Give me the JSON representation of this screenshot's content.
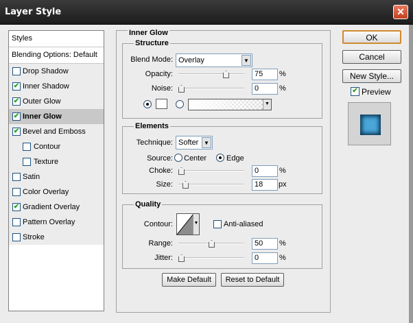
{
  "window": {
    "title": "Layer Style",
    "close_icon": "close-icon"
  },
  "styles_panel": {
    "header": "Styles",
    "blending_options": "Blending Options: Default",
    "items": [
      {
        "label": "Drop Shadow",
        "checked": false,
        "sub": false,
        "selected": false
      },
      {
        "label": "Inner Shadow",
        "checked": true,
        "sub": false,
        "selected": false
      },
      {
        "label": "Outer Glow",
        "checked": true,
        "sub": false,
        "selected": false
      },
      {
        "label": "Inner Glow",
        "checked": true,
        "sub": false,
        "selected": true
      },
      {
        "label": "Bevel and Emboss",
        "checked": true,
        "sub": false,
        "selected": false
      },
      {
        "label": "Contour",
        "checked": false,
        "sub": true,
        "selected": false
      },
      {
        "label": "Texture",
        "checked": false,
        "sub": true,
        "selected": false
      },
      {
        "label": "Satin",
        "checked": false,
        "sub": false,
        "selected": false
      },
      {
        "label": "Color Overlay",
        "checked": false,
        "sub": false,
        "selected": false
      },
      {
        "label": "Gradient Overlay",
        "checked": true,
        "sub": false,
        "selected": false
      },
      {
        "label": "Pattern Overlay",
        "checked": false,
        "sub": false,
        "selected": false
      },
      {
        "label": "Stroke",
        "checked": false,
        "sub": false,
        "selected": false
      }
    ]
  },
  "inner_glow": {
    "title": "Inner Glow",
    "structure": {
      "title": "Structure",
      "blend_mode_label": "Blend Mode:",
      "blend_mode": "Overlay",
      "opacity_label": "Opacity:",
      "opacity": "75",
      "opacity_unit": "%",
      "opacity_level": 0.75,
      "noise_label": "Noise:",
      "noise": "0",
      "noise_unit": "%",
      "noise_level": 0
    },
    "elements": {
      "title": "Elements",
      "technique_label": "Technique:",
      "technique": "Softer",
      "source_label": "Source:",
      "source_center": "Center",
      "source_edge": "Edge",
      "choke_label": "Choke:",
      "choke": "0",
      "choke_unit": "%",
      "choke_level": 0,
      "size_label": "Size:",
      "size": "18",
      "size_unit": "px",
      "size_level": 0.07
    },
    "quality": {
      "title": "Quality",
      "contour_label": "Contour:",
      "anti_aliased": "Anti-aliased",
      "range_label": "Range:",
      "range": "50",
      "range_unit": "%",
      "range_level": 0.5,
      "jitter_label": "Jitter:",
      "jitter": "0",
      "jitter_unit": "%",
      "jitter_level": 0
    },
    "make_default": "Make Default",
    "reset_default": "Reset to Default"
  },
  "actions": {
    "ok": "OK",
    "cancel": "Cancel",
    "new_style": "New Style...",
    "preview": "Preview"
  },
  "colors": {
    "preview": "#4aa6d8",
    "accent_button": "#d08a2c"
  }
}
